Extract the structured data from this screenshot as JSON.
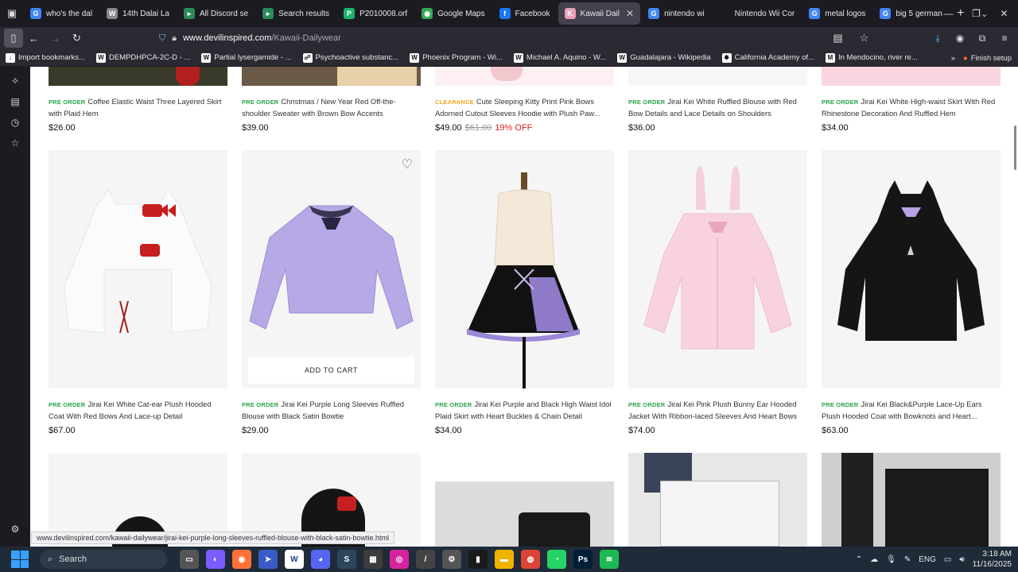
{
  "browser": {
    "tabs": [
      {
        "label": "who's the dal",
        "color": "#4285f4",
        "glyph": "G",
        "active": false
      },
      {
        "label": "14th Dalai La",
        "color": "#888888",
        "glyph": "W",
        "active": false
      },
      {
        "label": "All Discord se",
        "color": "#2b8a5a",
        "glyph": "▸",
        "active": false
      },
      {
        "label": "Search results",
        "color": "#2b8a5a",
        "glyph": "▸",
        "active": false
      },
      {
        "label": "P2010008.orf",
        "color": "#1bb56a",
        "glyph": "P",
        "active": false
      },
      {
        "label": "Google Maps",
        "color": "#34a853",
        "glyph": "◉",
        "active": false
      },
      {
        "label": "Facebook",
        "color": "#1877f2",
        "glyph": "f",
        "active": false
      },
      {
        "label": "Kawaii Dail",
        "color": "#e8a0b8",
        "glyph": "K",
        "active": true
      },
      {
        "label": "nintendo wi",
        "color": "#4285f4",
        "glyph": "G",
        "active": false
      },
      {
        "label": "Nintendo Wii Cor",
        "color": "#1c1b22",
        "glyph": "",
        "active": false
      },
      {
        "label": "metal logos",
        "color": "#4285f4",
        "glyph": "G",
        "active": false
      },
      {
        "label": "big 5 german",
        "color": "#4285f4",
        "glyph": "G",
        "active": false
      }
    ],
    "url_host": "www.devilinspired.com",
    "url_path": "/Kawaii-Dailywear",
    "bookmarks": [
      {
        "label": "Import bookmarks...",
        "glyph": "↓"
      },
      {
        "label": "DEMPDHPCA-2C-D - ...",
        "glyph": "W"
      },
      {
        "label": "Partial lysergamide - ...",
        "glyph": "W"
      },
      {
        "label": "Psychoactive substanc...",
        "glyph": "☍"
      },
      {
        "label": "Phoenix Program - Wi...",
        "glyph": "W"
      },
      {
        "label": "Michael A. Aquino - W...",
        "glyph": "W"
      },
      {
        "label": "Guadalajara - Wikipedia",
        "glyph": "W"
      },
      {
        "label": "California Academy of...",
        "glyph": "✹"
      },
      {
        "label": "In Mendocino, river re...",
        "glyph": "M"
      }
    ],
    "finish_setup": "Finish setup",
    "status_url": "www.devilinspired.com/kawaii-dailywear/jirai-kei-purple-long-sleeves-ruffled-blouse-with-black-satin-bowtie.html"
  },
  "products_top": [
    {
      "tag": "PRE ORDER",
      "tag_type": "pre",
      "title": "Coffee Elastic Waist Three Layered Skirt with Plaid Hem",
      "price": "$26.00",
      "old_price": "",
      "discount": ""
    },
    {
      "tag": "PRE ORDER",
      "tag_type": "pre",
      "title": "Christmas / New Year Red Off-the-shoulder Sweater with Brown Bow Accents",
      "price": "$39.00",
      "old_price": "",
      "discount": ""
    },
    {
      "tag": "CLEARANCE",
      "tag_type": "clear",
      "title": "Cute Sleeping Kitty Print Pink Bows Adorned Cutout Sleeves Hoodie with Plush Paw...",
      "price": "$49.00",
      "old_price": "$61.00",
      "discount": "19% OFF"
    },
    {
      "tag": "PRE ORDER",
      "tag_type": "pre",
      "title": "Jirai Kei White Ruffled Blouse with Red Bow Details and Lace Details on Shoulders",
      "price": "$36.00",
      "old_price": "",
      "discount": ""
    },
    {
      "tag": "PRE ORDER",
      "tag_type": "pre",
      "title": "Jirai Kei White High-waist Skirt With Red Rhinestone Decoration And Ruffled Hem",
      "price": "$34.00",
      "old_price": "",
      "discount": ""
    }
  ],
  "products_mid": [
    {
      "tag": "PRE ORDER",
      "title": "Jirai Kei White Cat-ear Plush Hooded Coat With Red Bows And Lace-up Detail",
      "price": "$67.00"
    },
    {
      "tag": "PRE ORDER",
      "title": "Jirai Kei Purple Long Sleeves Ruffled Blouse with Black Satin Bowtie",
      "price": "$29.00"
    },
    {
      "tag": "PRE ORDER",
      "title": "Jirai Kei Purple and Black High Waist Idol Plaid Skirt with Heart Buckles & Chain Detail",
      "price": "$34.00"
    },
    {
      "tag": "PRE ORDER",
      "title": "Jirai Kei Pink Plush Bunny Ear Hooded Jacket With Ribbon-laced Sleeves And Heart Bows",
      "price": "$74.00"
    },
    {
      "tag": "PRE ORDER",
      "title": "Jirai Kei Black&Purple Lace-Up Ears Plush Hooded Coat with Bowknots and Heart...",
      "price": "$63.00"
    }
  ],
  "add_to_cart_label": "ADD TO CART",
  "taskbar": {
    "search_label": "Search",
    "lang": "ENG",
    "time": "3:18 AM",
    "date": "11/16/2025",
    "apps": [
      {
        "name": "file-icon",
        "color": "#555555",
        "glyph": "▭"
      },
      {
        "name": "copilot-icon",
        "color": "#7b5cff",
        "glyph": "◐"
      },
      {
        "name": "firefox-icon",
        "color": "#ff7139",
        "glyph": "◉"
      },
      {
        "name": "vscode-icon",
        "color": "#3a5bc7",
        "glyph": "➤"
      },
      {
        "name": "wordpad-icon",
        "color": "#ffffff",
        "glyph": "W"
      },
      {
        "name": "discord-icon",
        "color": "#5865f2",
        "glyph": "◕"
      },
      {
        "name": "steam-icon",
        "color": "#2a475e",
        "glyph": "S"
      },
      {
        "name": "calculator-icon",
        "color": "#3c3c3c",
        "glyph": "▦"
      },
      {
        "name": "instagram-icon",
        "color": "#d6249f",
        "glyph": "◎"
      },
      {
        "name": "pen-icon",
        "color": "#444444",
        "glyph": "/"
      },
      {
        "name": "settings-icon",
        "color": "#555555",
        "glyph": "⚙"
      },
      {
        "name": "stats-icon",
        "color": "#1a1a1a",
        "glyph": "▮"
      },
      {
        "name": "folder-icon",
        "color": "#f0b400",
        "glyph": "▬"
      },
      {
        "name": "chrome-icon",
        "color": "#db4437",
        "glyph": "◍"
      },
      {
        "name": "whatsapp-icon",
        "color": "#25d366",
        "glyph": "◔"
      },
      {
        "name": "photoshop-icon",
        "color": "#001e36",
        "glyph": "Ps"
      },
      {
        "name": "spotify-icon",
        "color": "#1db954",
        "glyph": "≋"
      }
    ]
  }
}
